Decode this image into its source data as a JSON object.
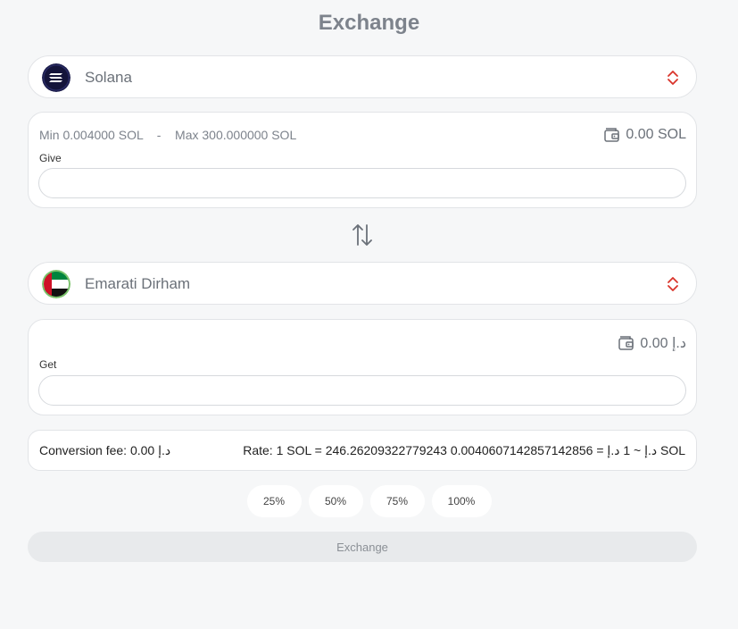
{
  "title": "Exchange",
  "give": {
    "currency": "Solana",
    "currency_icon": "solana-logo",
    "min_label": "Min 0.004000 SOL",
    "separator": "-",
    "max_label": "Max 300.000000 SOL",
    "balance": "0.00 SOL",
    "field_label": "Give",
    "value": ""
  },
  "get": {
    "currency": "Emarati Dirham",
    "currency_icon": "uae-flag",
    "balance": "0.00 د.إ",
    "field_label": "Get",
    "value": ""
  },
  "conversion": {
    "fee": "Conversion fee: 0.00 د.إ",
    "rate": "Rate: 1 SOL = 246.26209322779243 د.إ ~ 1 د.إ = 0.0040607142857142856 SOL"
  },
  "percent_buttons": [
    "25%",
    "50%",
    "75%",
    "100%"
  ],
  "submit_label": "Exchange",
  "colors": {
    "chevron": "#d9342b",
    "solana_bg": "#1b1c4a",
    "uae_green": "#00843d",
    "uae_red": "#ce1126",
    "uae_black": "#111111",
    "logo_ring": "#7ac26b"
  }
}
